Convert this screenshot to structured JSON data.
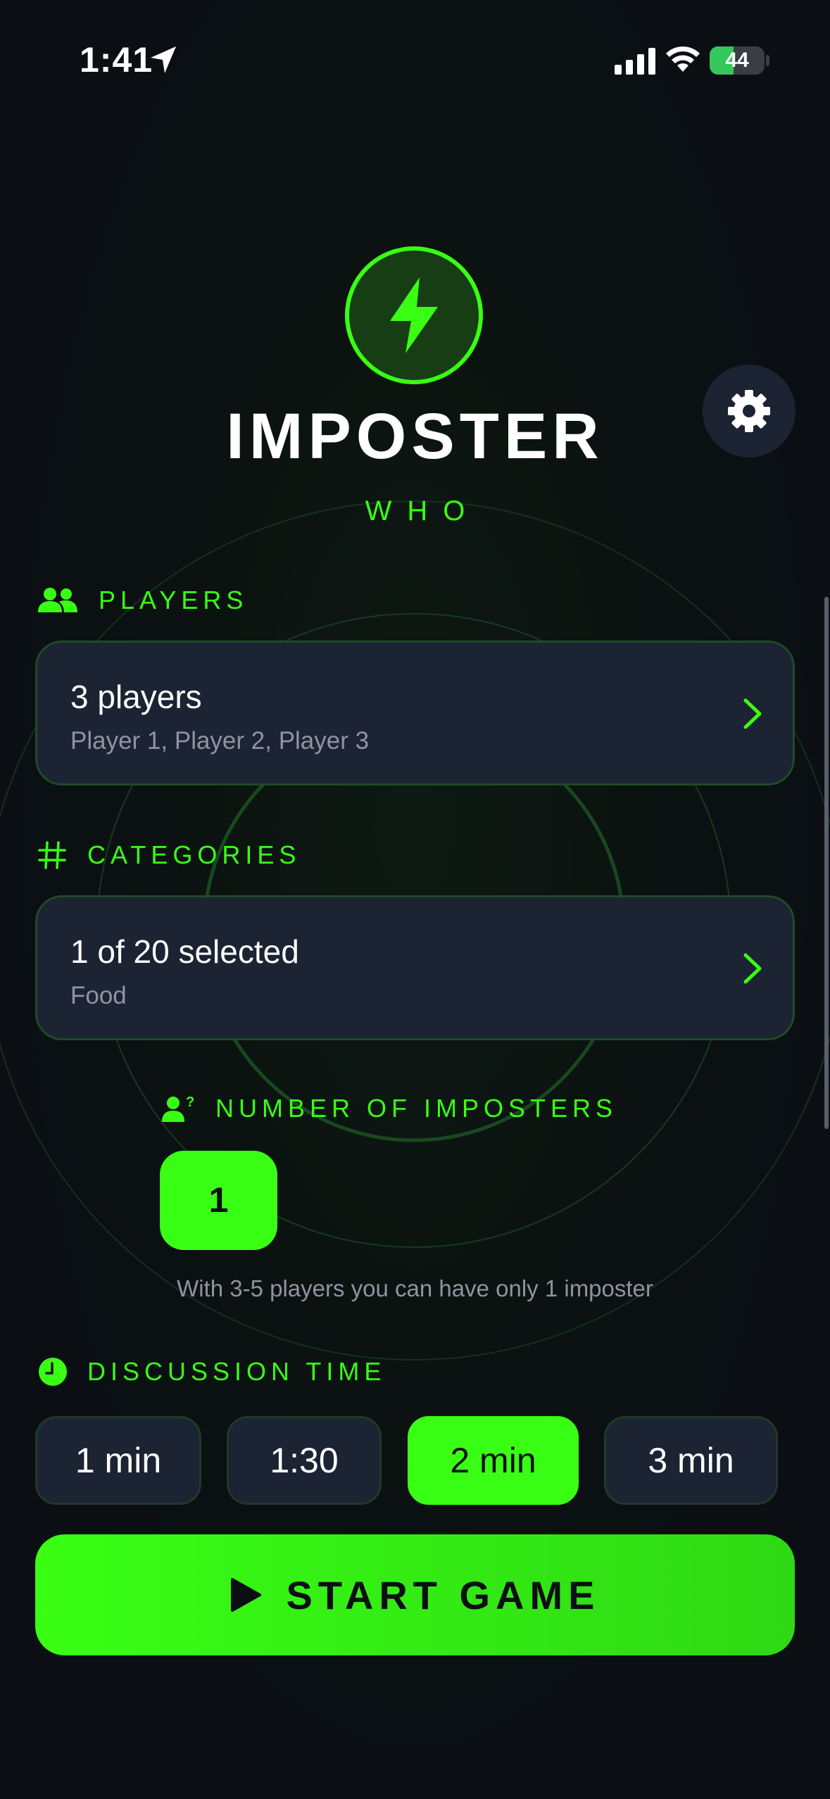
{
  "status_bar": {
    "time": "1:41",
    "battery_level": "44",
    "battery_fraction": 0.44,
    "signal_icon": "signal-bars-icon",
    "wifi_icon": "wifi-icon",
    "location_icon": "location-arrow-icon"
  },
  "header": {
    "logo_icon": "lightning-bolt-icon",
    "title": "IMPOSTER",
    "subtitle": "WHO",
    "settings_icon": "gear-icon"
  },
  "players": {
    "label": "PLAYERS",
    "icon": "people-icon",
    "summary": "3 players",
    "names": "Player 1, Player 2, Player 3"
  },
  "categories": {
    "label": "CATEGORIES",
    "icon": "hashtag-icon",
    "summary": "1 of 20 selected",
    "selected": "Food"
  },
  "imposters": {
    "label": "NUMBER OF IMPOSTERS",
    "icon": "person-question-icon",
    "value": "1",
    "hint": "With 3-5 players you can have only 1 imposter"
  },
  "discussion": {
    "label": "DISCUSSION TIME",
    "icon": "clock-icon",
    "options": [
      "1 min",
      "1:30",
      "2 min",
      "3 min"
    ],
    "selected": "2 min"
  },
  "start_button": {
    "label": "START GAME",
    "icon": "play-icon"
  },
  "colors": {
    "accent": "#39ff14",
    "background": "#0b0f14",
    "card": "#1c2333",
    "muted_text": "#8e94a0"
  }
}
